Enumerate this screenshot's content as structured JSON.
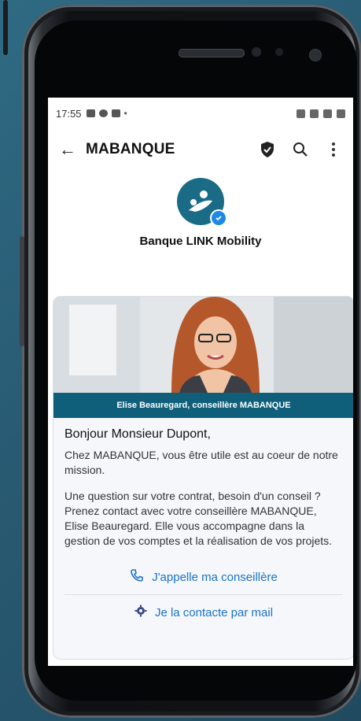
{
  "status_bar": {
    "time": "17:55"
  },
  "app_bar": {
    "title": "MABANQUE",
    "back_icon": "arrow-left-icon",
    "shield_icon": "shield-icon",
    "search_icon": "search-icon",
    "menu_icon": "more-vert-icon"
  },
  "profile": {
    "name": "Banque LINK Mobility"
  },
  "card": {
    "caption": "Elise Beauregard, conseillère MABANQUE",
    "greeting": "Bonjour Monsieur Dupont,",
    "paragraph1": "Chez MABANQUE, vous être utile est au coeur de notre mission.",
    "paragraph2": "Une question sur votre contrat, besoin d'un conseil ? Prenez contact avec votre conseillère MABANQUE, Elise Beauregard. Elle vous accompagne dans la gestion de vos comptes et la réalisation de vos projets.",
    "action_call": "J'appelle ma conseillère",
    "action_mail": "Je la contacte par mail"
  },
  "colors": {
    "brand": "#1a6b86",
    "caption_bg": "#0f5f7a",
    "link": "#1a73c9"
  }
}
